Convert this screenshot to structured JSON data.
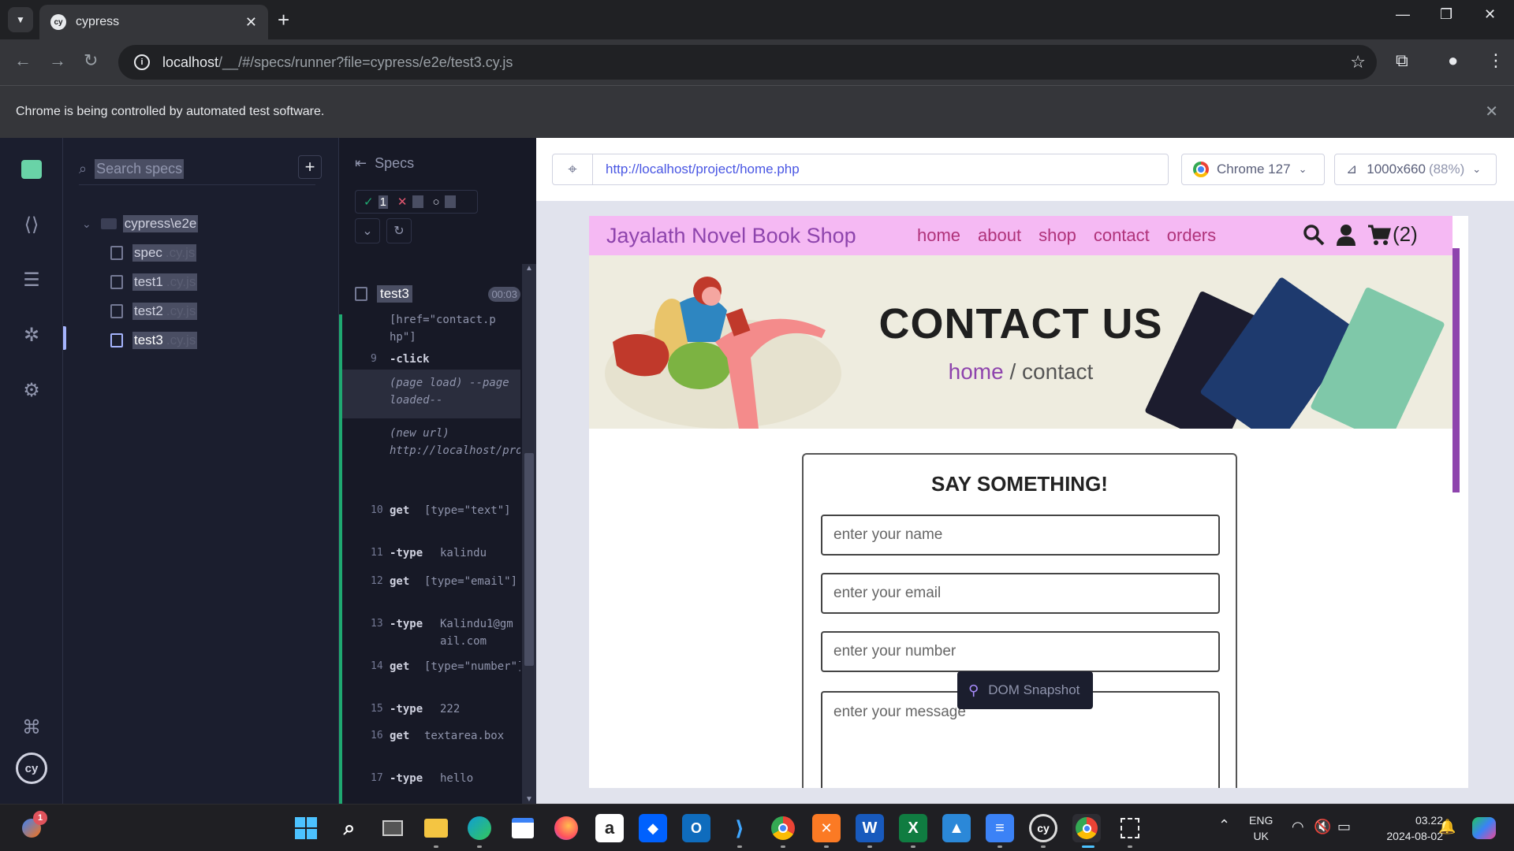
{
  "browser": {
    "tab_title": "cypress",
    "tab_favicon": "cy",
    "address": "localhost/__/#/specs/runner?file=cypress/e2e/test3.cy.js",
    "address_host": "localhost",
    "address_rest": "/__/#/specs/runner?file=cypress/e2e/test3.cy.js",
    "infobar_message": "Chrome is being controlled by automated test software."
  },
  "specs_panel": {
    "search_placeholder": "Search specs",
    "folder": "cypress\\e2e",
    "files": [
      {
        "name": "spec",
        "ext": ".cy.js"
      },
      {
        "name": "test1",
        "ext": ".cy.js"
      },
      {
        "name": "test2",
        "ext": ".cy.js"
      },
      {
        "name": "test3",
        "ext": ".cy.js"
      }
    ]
  },
  "reporter": {
    "header": "Specs",
    "passed_count": "1",
    "spec_name": "test3",
    "duration": "00:03",
    "commands": [
      {
        "n": "",
        "name": "",
        "arg": "[href=\"contact.p hp\"]"
      },
      {
        "n": "9",
        "name": "-click",
        "arg": ""
      },
      {
        "n": "",
        "name": "",
        "event": "(page load) --page loaded--"
      },
      {
        "n": "",
        "name": "",
        "event": "(new url) http://localhost/project/contact.php"
      },
      {
        "n": "10",
        "name": "get",
        "arg": "[type=\"text\"]"
      },
      {
        "n": "11",
        "name": "-type",
        "arg": "kalindu"
      },
      {
        "n": "12",
        "name": "get",
        "arg": "[type=\"email\"]"
      },
      {
        "n": "13",
        "name": "-type",
        "arg": "Kalindu1@gmail.com"
      },
      {
        "n": "14",
        "name": "get",
        "arg": "[type=\"number\"]"
      },
      {
        "n": "15",
        "name": "-type",
        "arg": "222"
      },
      {
        "n": "16",
        "name": "get",
        "arg": "textarea.box"
      },
      {
        "n": "17",
        "name": "-type",
        "arg": "hello"
      }
    ]
  },
  "aut": {
    "url": "http://localhost/project/home.php",
    "browser": "Chrome 127",
    "viewport": "1000x660",
    "viewport_scale": "(88%)",
    "dom_snapshot_label": "DOM Snapshot"
  },
  "site": {
    "logo": "Jayalath Novel Book Shop",
    "nav": [
      "home",
      "about",
      "shop",
      "contact",
      "orders"
    ],
    "cart_count": "(2)",
    "hero_title": "CONTACT US",
    "crumb_home": "home",
    "crumb_sep": " / ",
    "crumb_current": "contact",
    "form_title": "SAY SOMETHING!",
    "name_placeholder": "enter your name",
    "email_placeholder": "enter your email",
    "number_placeholder": "enter your number",
    "message_placeholder": "enter your message"
  },
  "taskbar": {
    "notification_badge": "1",
    "lang_top": "ENG",
    "lang_bottom": "UK",
    "time": "03.22",
    "date": "2024-08-02"
  },
  "colors": {
    "cypress_green": "#1fa971",
    "cypress_indigo": "#a5b4fc",
    "site_pink": "#f5b9f3",
    "site_purple": "#8e44ad"
  }
}
